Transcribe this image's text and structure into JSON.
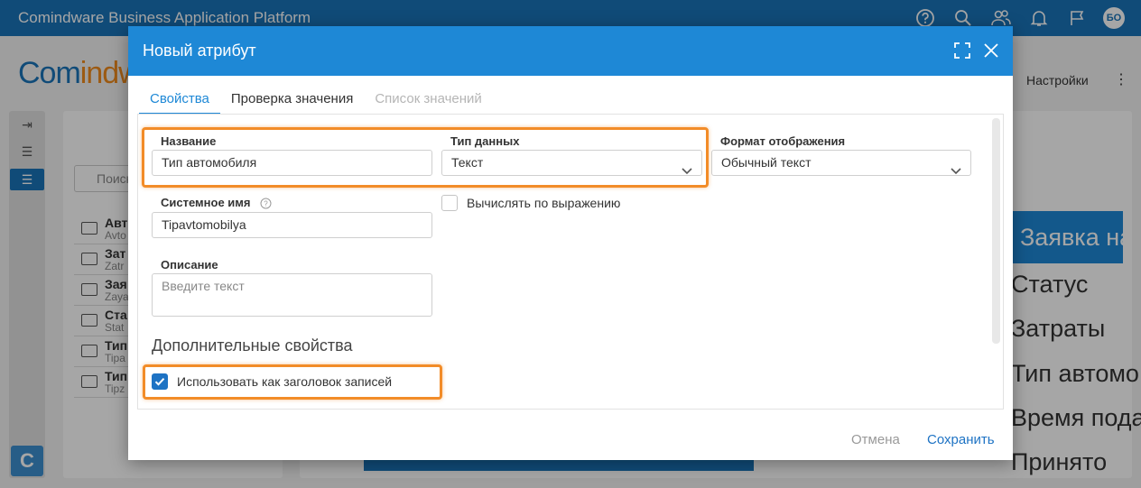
{
  "app": {
    "title": "Comindware Business Application Platform",
    "avatar_initials": "БО"
  },
  "topbar_icons": [
    "help-icon",
    "search-icon",
    "users-icon",
    "bell-icon",
    "flag-icon"
  ],
  "background": {
    "logo_left": "Com",
    "logo_mid": "indw",
    "settings_label": "Настройки",
    "kebab": "⋮",
    "search_placeholder": "Поиск",
    "list_rows": [
      {
        "title": "Авт",
        "subtitle": "Avto"
      },
      {
        "title": "Зат",
        "subtitle": "Zatr"
      },
      {
        "title": "Зая",
        "subtitle": "Zaya"
      },
      {
        "title": "Ста",
        "subtitle": "Stat"
      },
      {
        "title": "Тип",
        "subtitle": "Tipa"
      },
      {
        "title": "Тип",
        "subtitle": "Tipz"
      }
    ],
    "right_header": "Заявка на",
    "right_items": [
      "Статус",
      "Затраты",
      "Тип автомо",
      "Время пода",
      "Принято"
    ],
    "c_button": "C"
  },
  "modal": {
    "title": "Новый атрибут",
    "tabs": [
      {
        "label": "Свойства",
        "state": "active"
      },
      {
        "label": "Проверка значения",
        "state": "normal"
      },
      {
        "label": "Список значений",
        "state": "disabled"
      }
    ],
    "fields": {
      "name_label": "Название",
      "name_value": "Тип автомобиля",
      "datatype_label": "Тип данных",
      "datatype_value": "Текст",
      "format_label": "Формат отображения",
      "format_value": "Обычный текст",
      "sysname_label": "Системное имя",
      "sysname_value": "Tipavtomobilya",
      "compute_label": "Вычислять по выражению",
      "compute_checked": false,
      "description_label": "Описание",
      "description_placeholder": "Введите текст"
    },
    "additional_title": "Дополнительные свойства",
    "use_as_header_label": "Использовать как заголовок записей",
    "use_as_header_checked": true,
    "cancel_label": "Отмена",
    "save_label": "Сохранить"
  },
  "colors": {
    "brand_blue": "#1973b9",
    "header_blue": "#1e88d6",
    "highlight_orange": "#f28c28"
  }
}
